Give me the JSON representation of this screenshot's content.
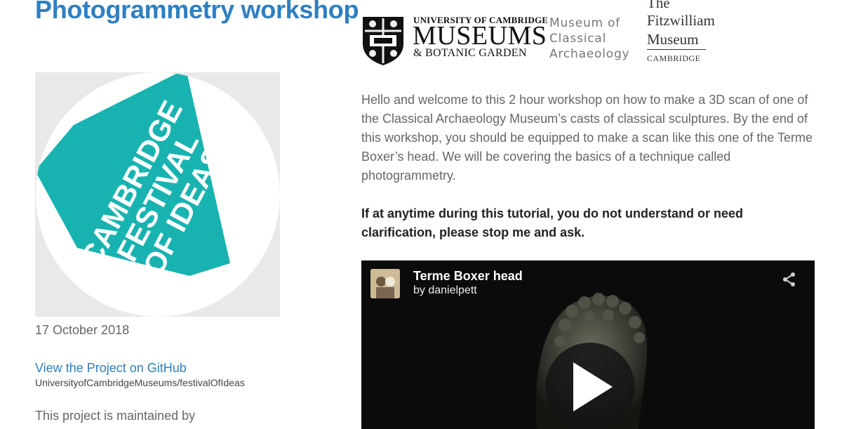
{
  "page": {
    "title": "Photogrammetry workshop",
    "date": "17 October 2018",
    "github_link": "View the Project on GitHub",
    "github_repo": "UniversityofCambridgeMuseums/festivalOfIdeas",
    "maintained_by": "This project is maintained by"
  },
  "festival_logo": {
    "line1": "CAMBRIDGE",
    "line2": "FESTIVAL",
    "line3": "OF IDEAS",
    "accent": "#18b3b0"
  },
  "logos": {
    "ucm_top": "UNIVERSITY OF CAMBRIDGE",
    "ucm_mid": "MUSEUMS",
    "ucm_bottom": "& BOTANIC GARDEN",
    "moca_line1": "Museum of",
    "moca_line2": "Classical",
    "moca_line3": "Archaeology",
    "fitz_the": "The",
    "fitz_line1": "Fitzwilliam",
    "fitz_line2": "Museum",
    "fitz_city": "CAMBRIDGE"
  },
  "content": {
    "intro": "Hello and welcome to this 2 hour workshop on how to make a 3D scan of one of the Classical Archaeology Museum’s casts of classical sculptures. By the end of this workshop, you should be equipped to make a scan like this one of the Terme Boxer’s head. We will be covering the basics of a technique called photogrammetry.",
    "note": "If at anytime during this tutorial, you do not understand or need clarification, please stop me and ask."
  },
  "viewer": {
    "model_title": "Terme Boxer head",
    "author": "by danielpett",
    "share_icon": "share-icon",
    "play_icon": "play-icon"
  },
  "colors": {
    "link": "#2f7fc1",
    "title": "#2f7fc1",
    "teal": "#18b3b0"
  }
}
